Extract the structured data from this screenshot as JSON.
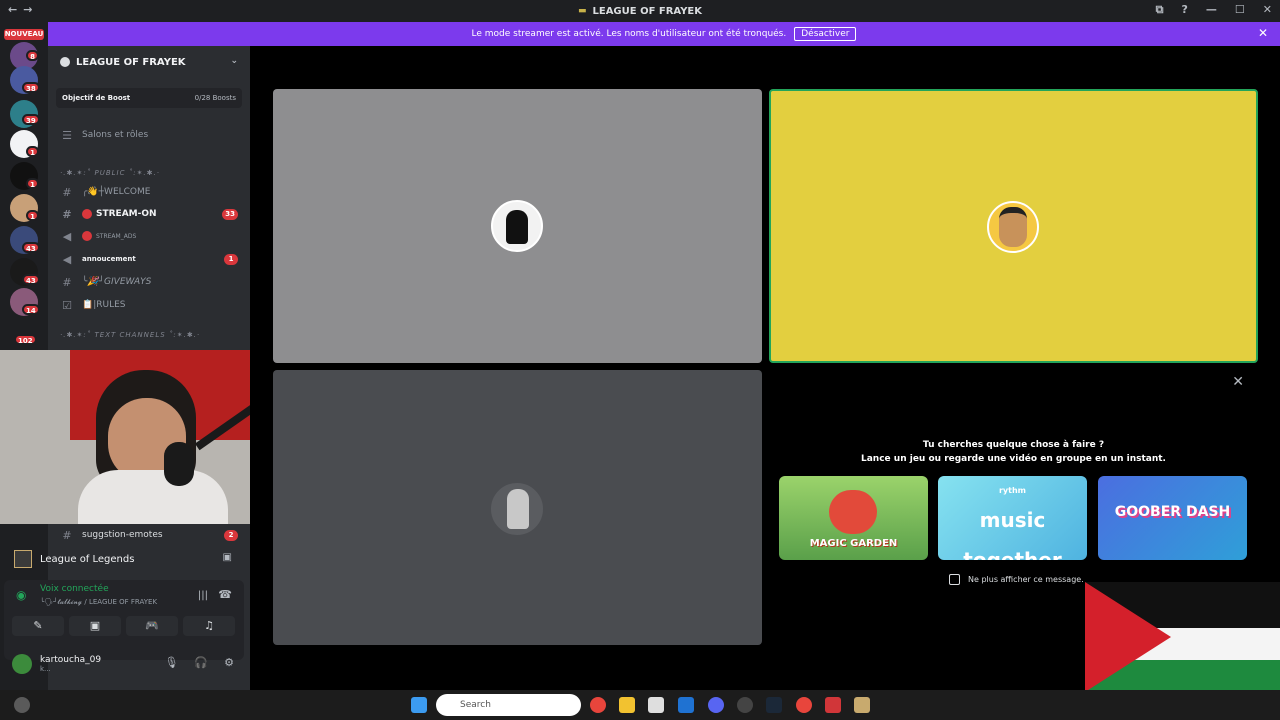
{
  "window": {
    "title": "LEAGUE OF FRAYEK",
    "nav_back": "←",
    "nav_forward": "→",
    "controls": [
      "⧉",
      "?",
      "—",
      "☐",
      "✕"
    ]
  },
  "banner": {
    "text": "Le mode streamer est activé. Les noms d'utilisateur ont été tronqués.",
    "button": "Désactiver",
    "close": "✕"
  },
  "rail": {
    "new_label": "NOUVEAU",
    "badges": [
      "8",
      "38",
      "39",
      "1",
      "1",
      "1",
      "43",
      "43",
      "14",
      "102"
    ]
  },
  "server": {
    "name": "LEAGUE OF FRAYEK",
    "boost_label": "Objectif de Boost",
    "boost_value": "0/28 Boosts",
    "channels_roles": "Salons et rôles"
  },
  "channels": [
    {
      "name": "·.✱.✶:˚ PUBLIC ˚:✶.✱.·",
      "type": "category"
    },
    {
      "name": "╭👋┼WELCOME",
      "type": "text"
    },
    {
      "name": "STREAM-ON",
      "type": "text",
      "badge": "33"
    },
    {
      "name": "STREAM_ADS",
      "type": "voice"
    },
    {
      "name": "annoucement",
      "type": "voice",
      "badge": "1"
    },
    {
      "name": "╰🎉┘GIVEWAYS",
      "type": "text"
    },
    {
      "name": "📋|RULES",
      "type": "rules"
    },
    {
      "name": "·.✱.✶:˚ TEXT CHANNELS ˚:✶.✱.·",
      "type": "category"
    },
    {
      "name": "suggstion-emotes",
      "type": "text",
      "badge": "2"
    }
  ],
  "activity": {
    "game": "League of Legends"
  },
  "voice": {
    "status": "Voix connectée",
    "channel": "╰🗣┘𝓽𝓪𝓵𝓴𝓲𝓷𝓰 / LEAGUE OF FRAYEK"
  },
  "user": {
    "name": "kartoucha_09",
    "status": "k..."
  },
  "activity_panel": {
    "line1": "Tu cherches quelque chose à faire ?",
    "line2": "Lance un jeu ou regarde une vidéo en groupe en un instant.",
    "cards": [
      {
        "title": "MAGIC GARDEN"
      },
      {
        "title": "music together",
        "brand": "rythm"
      },
      {
        "title": "GOOBER DASH"
      }
    ],
    "dont_show": "Ne plus afficher ce message."
  },
  "taskbar": {
    "search_placeholder": "Search"
  },
  "colors": {
    "accent": "#7c3aed",
    "speaking": "#23a55a",
    "badge": "#da373c",
    "tile_yellow": "#e3cf3f"
  }
}
